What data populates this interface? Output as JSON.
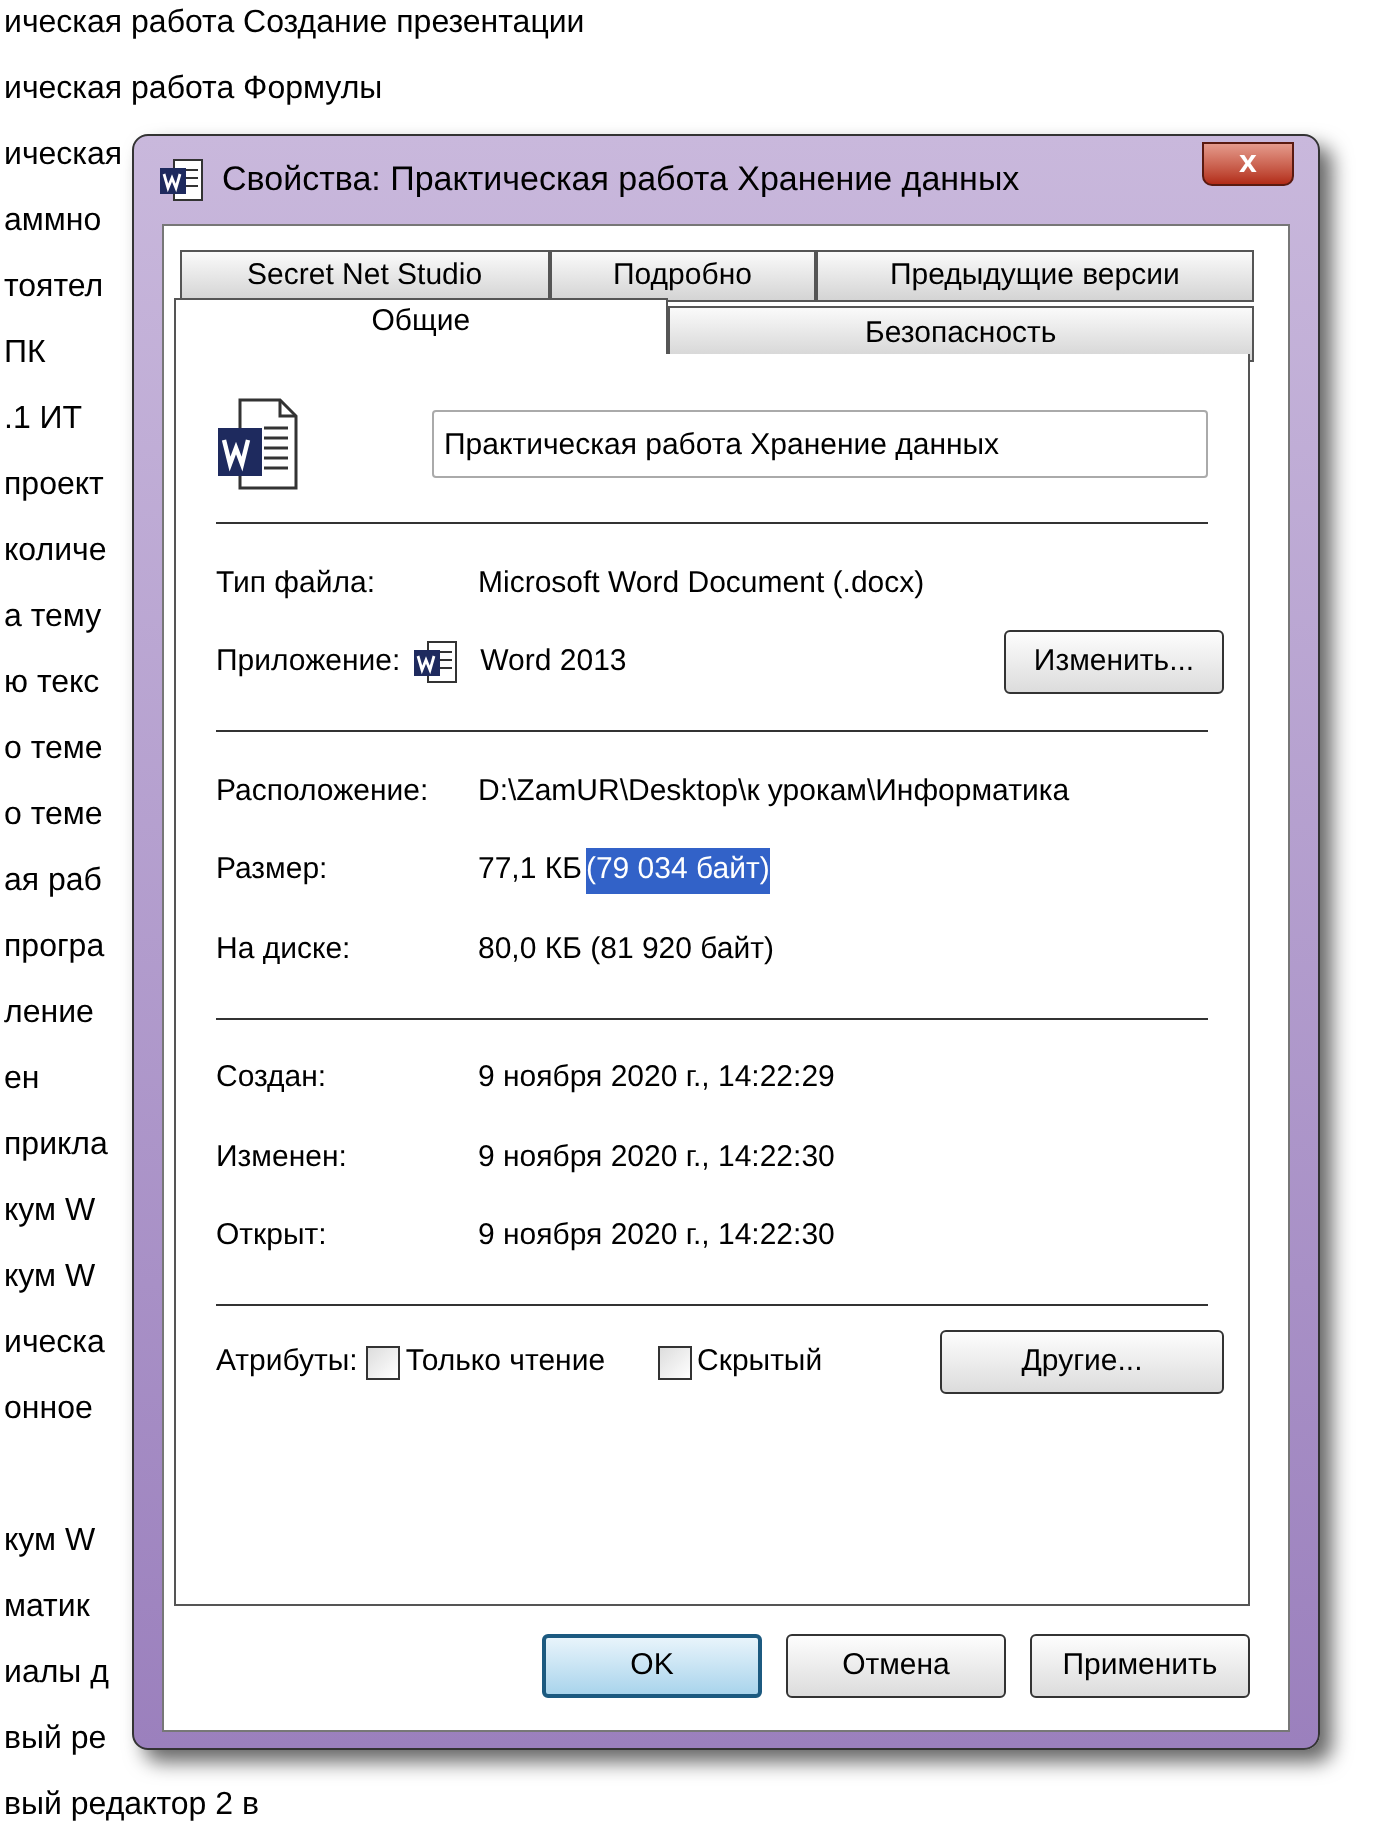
{
  "background_list": [
    "ическая работа Создание презентации",
    "ическая работа Формулы",
    "ическая",
    "аммно",
    "тоятел",
    "ПК",
    ".1 ИТ",
    "проект",
    "количе",
    "а тему",
    "ю текс",
    "о теме",
    "о теме",
    "ая раб",
    "програ",
    "ление",
    "ен",
    "прикла",
    "кум W",
    "кум W",
    "ическа",
    "онное"
  ],
  "background_list_lower": [
    "кум W",
    "матик",
    "иалы д",
    "вый ре",
    "вый редактор 2 в"
  ],
  "window": {
    "title": "Свойства: Практическая работа Хранение данных",
    "close": "x"
  },
  "tabs_row_1": [
    {
      "label": "Secret Net Studio",
      "selected": false
    },
    {
      "label": "Подробно",
      "selected": false
    },
    {
      "label": "Предыдущие версии",
      "selected": false
    }
  ],
  "tabs_row_2": [
    {
      "label": "Общие",
      "selected": true
    },
    {
      "label": "Безопасность",
      "selected": false
    }
  ],
  "file_name": {
    "value": "Практическая работа Хранение данных"
  },
  "sections": [
    [
      {
        "label": "Тип файла:",
        "value": "Microsoft Word Document (.docx)"
      },
      {
        "label": "Приложение:",
        "value": "Word 2013",
        "kind": "app",
        "button": "Изменить..."
      }
    ],
    [
      {
        "label": "Расположение:",
        "value": "D:\\ZamUR\\Desktop\\к урокам\\Информатика"
      },
      {
        "label": "Размер:",
        "value": "77,1 КБ",
        "selection": "(79 034 байт)"
      },
      {
        "label": "На диске:",
        "value": "80,0 КБ (81 920 байт)"
      }
    ],
    [
      {
        "label": "Создан:",
        "value": "9 ноября 2020 г., 14:22:29"
      },
      {
        "label": "Изменен:",
        "value": "9 ноября 2020 г., 14:22:30"
      },
      {
        "label": "Открыт:",
        "value": "9 ноября 2020 г., 14:22:30"
      }
    ]
  ],
  "attributes": {
    "label": "Атрибуты:",
    "checkboxes": [
      {
        "label": "Только чтение",
        "checked": false
      },
      {
        "label": "Скрытый",
        "checked": false
      }
    ],
    "button": "Другие..."
  },
  "buttons": [
    {
      "label": "OK",
      "kind": "default"
    },
    {
      "label": "Отмена",
      "kind": "normal"
    },
    {
      "label": "Применить",
      "kind": "normal"
    }
  ]
}
